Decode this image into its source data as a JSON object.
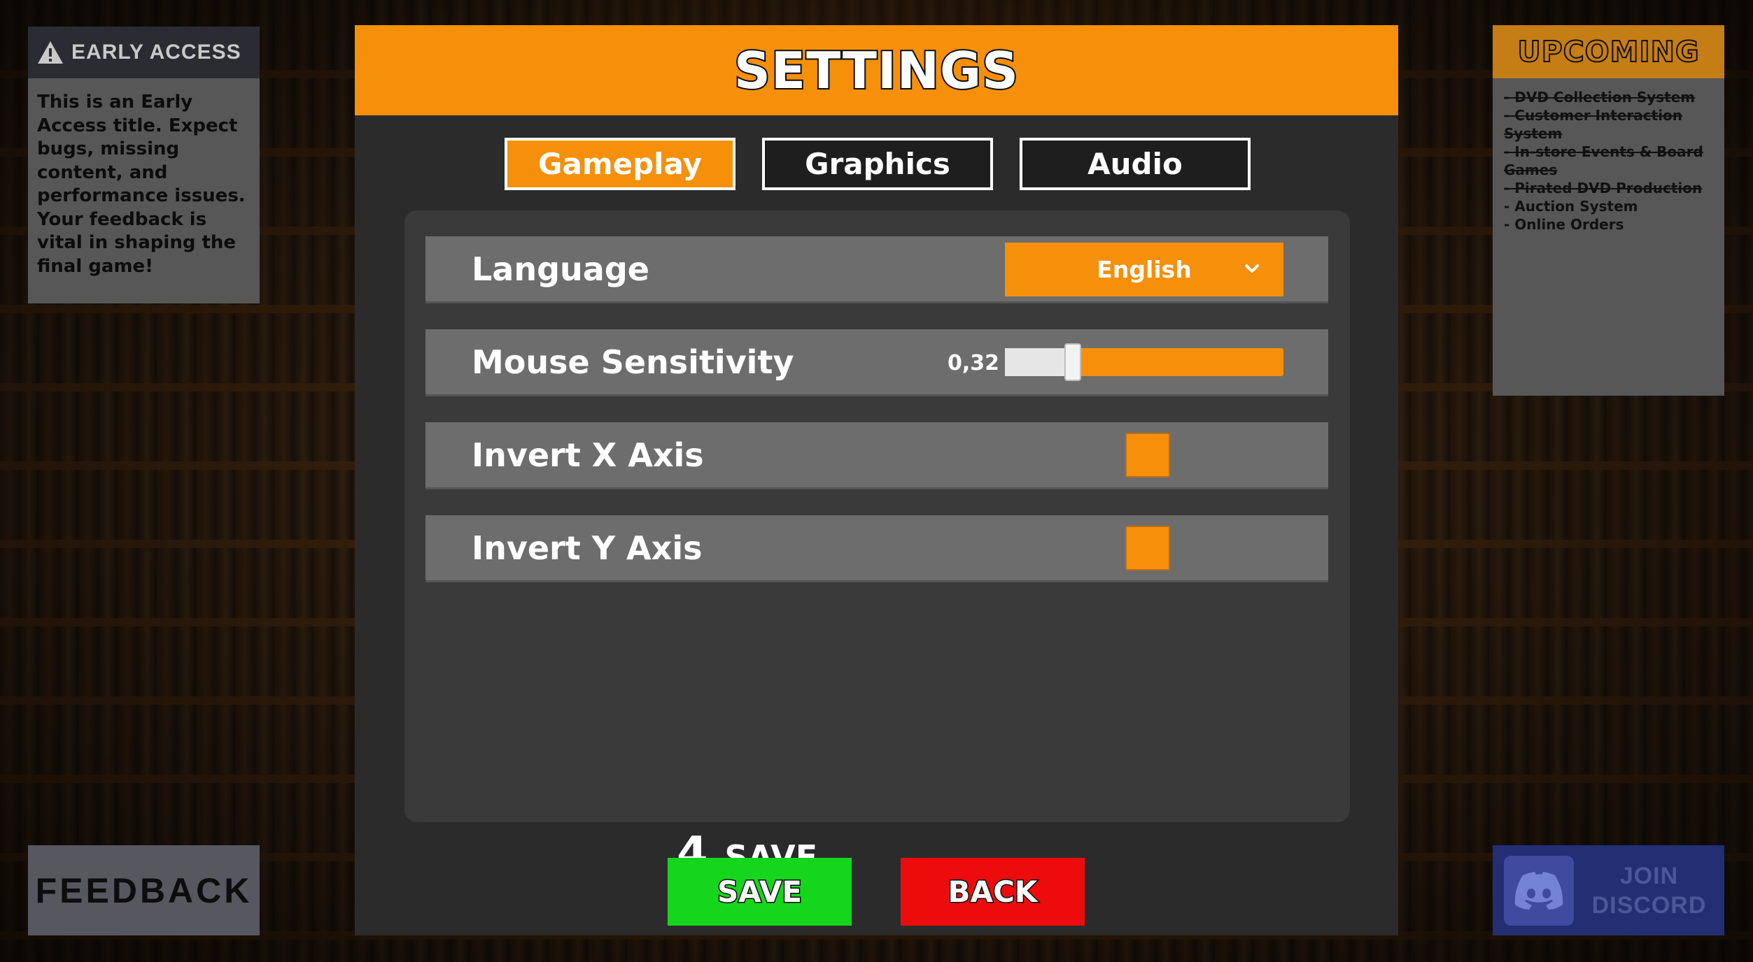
{
  "early_access": {
    "title": "EARLY ACCESS",
    "body": "This is an Early Access title. Expect bugs, missing content, and performance issues. Your feedback is vital in shaping the final game!"
  },
  "upcoming": {
    "title": "UPCOMING",
    "items": [
      {
        "label": "- DVD Collection System",
        "completed": true
      },
      {
        "label": "- Customer Interaction System",
        "completed": true
      },
      {
        "label": "- In-store Events & Board Games",
        "completed": true
      },
      {
        "label": "- Pirated DVD Production",
        "completed": true
      },
      {
        "label": "- Auction System",
        "completed": false
      },
      {
        "label": "- Online Orders",
        "completed": false
      }
    ]
  },
  "feedback": {
    "label": "FEEDBACK"
  },
  "discord": {
    "line1": "JOIN",
    "line2": "DISCORD"
  },
  "settings": {
    "title": "SETTINGS",
    "tabs": [
      {
        "label": "Gameplay",
        "active": true
      },
      {
        "label": "Graphics",
        "active": false
      },
      {
        "label": "Audio",
        "active": false
      }
    ],
    "rows": {
      "language": {
        "label": "Language",
        "value": "English"
      },
      "mouse_sensitivity": {
        "label": "Mouse Sensitivity",
        "value_text": "0,32",
        "value": 0.32,
        "min": 0.1,
        "max": 1.0
      },
      "invert_x": {
        "label": "Invert X Axis",
        "checked": false
      },
      "invert_y": {
        "label": "Invert Y Axis",
        "checked": false
      }
    },
    "save_hint": {
      "key": "4",
      "label": "SAVE"
    },
    "buttons": {
      "save": "SAVE",
      "back": "BACK"
    }
  },
  "colors": {
    "accent": "#f6900a",
    "save": "#15d61c",
    "back": "#ee0b0b",
    "discord": "#242e73"
  }
}
